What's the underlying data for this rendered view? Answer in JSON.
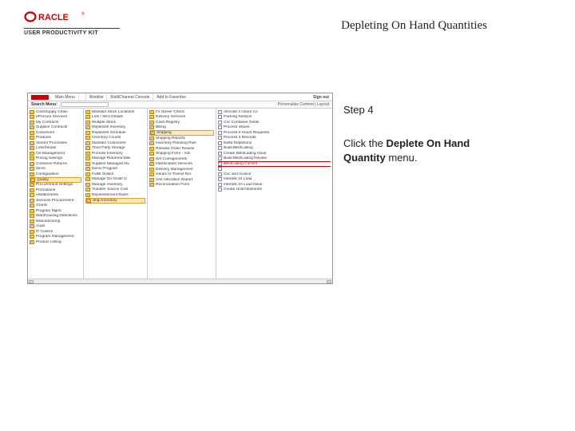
{
  "brand": {
    "upk": "USER PRODUCTIVITY KIT"
  },
  "title": "Depleting On Hand Quantities",
  "side": {
    "step": "Step 4",
    "instr_pre": "Click the ",
    "instr_bold": "Deplete On Hand Quantity",
    "instr_post": " menu."
  },
  "appbar": {
    "seg1": "Main Menu",
    "seg3": "Worklist",
    "seg4": "MultiChannel Console",
    "seg5": "Add to Favorites",
    "sign": "Sign out"
  },
  "subbar": {
    "label": "Search Menu:",
    "right": "Personalize Content | Layout"
  },
  "col0": [
    {
      "t": "folder",
      "l": "Cust/Supply Chain"
    },
    {
      "t": "folder",
      "l": "eProcure Services"
    },
    {
      "t": "folder",
      "l": "My Contracts"
    },
    {
      "t": "folder",
      "l": "Supplier Contracts"
    },
    {
      "t": "folder",
      "l": "Customers"
    },
    {
      "t": "folder",
      "l": "Products"
    },
    {
      "t": "folder",
      "l": "Vendor Processes"
    },
    {
      "t": "folder",
      "l": "Lots/Serials"
    },
    {
      "t": "folder",
      "l": "On-Management"
    },
    {
      "t": "folder",
      "l": "Pricing Savings"
    },
    {
      "t": "folder",
      "l": "Customer Returns"
    },
    {
      "t": "folder",
      "l": "Items"
    },
    {
      "t": "folder",
      "l": "Configuration"
    },
    {
      "t": "folder",
      "l": "Quality",
      "sel": true
    },
    {
      "t": "folder",
      "l": "Procurement Settings"
    },
    {
      "t": "folder",
      "l": "Promotions"
    },
    {
      "t": "folder",
      "l": "eSettlements"
    },
    {
      "t": "folder",
      "l": "Services Procurement"
    },
    {
      "t": "folder",
      "l": "Grants"
    },
    {
      "t": "folder",
      "l": "Program Mgmt"
    },
    {
      "t": "folder",
      "l": "Warehousing Definitions"
    },
    {
      "t": "folder",
      "l": "Manufacturing"
    },
    {
      "t": "folder",
      "l": "Audit"
    },
    {
      "t": "folder",
      "l": "IT Control"
    },
    {
      "t": "folder",
      "l": "Program Management"
    },
    {
      "t": "folder",
      "l": "Product Listing"
    }
  ],
  "col1": [
    {
      "t": "folder",
      "l": "Maintain Stock Locations"
    },
    {
      "t": "folder",
      "l": "Lots / SKU Details"
    },
    {
      "t": "folder",
      "l": "Multiple Stock"
    },
    {
      "t": "folder",
      "l": "Replenish Inventory"
    },
    {
      "t": "folder",
      "l": "Replenish Schedule"
    },
    {
      "t": "folder",
      "l": "Inventory Counts"
    },
    {
      "t": "folder",
      "l": "Maintain Customers"
    },
    {
      "t": "folder",
      "l": "Third Party Storage"
    },
    {
      "t": "folder",
      "l": "Promise Inventory"
    },
    {
      "t": "folder",
      "l": "Manage Returned Mat."
    },
    {
      "t": "folder",
      "l": "Supplier Managed Inv."
    },
    {
      "t": "folder",
      "l": "Demo Program"
    },
    {
      "t": "folder",
      "l": "Fulfill Orders"
    },
    {
      "t": "folder",
      "l": "Manage On-Order D"
    },
    {
      "t": "folder",
      "l": "Manage Inventory"
    },
    {
      "t": "folder",
      "l": "Transfer Source Cost"
    },
    {
      "t": "folder",
      "l": "Replenishment Rules"
    },
    {
      "t": "folder",
      "l": "Ship Inventory",
      "sel": true
    }
  ],
  "col2": [
    {
      "t": "folder",
      "l": "Fx Owner Check"
    },
    {
      "t": "folder",
      "l": "Delivery Services"
    },
    {
      "t": "folder",
      "l": "Cash Registry"
    },
    {
      "t": "folder",
      "l": "Billing"
    },
    {
      "t": "folder",
      "l": "Shipping",
      "sel": true
    },
    {
      "t": "folder",
      "l": "Shipping Reports"
    },
    {
      "t": "folder",
      "l": "Inventory Planning Rule"
    },
    {
      "t": "folder",
      "l": "Release Order Review"
    },
    {
      "t": "folder",
      "l": "Shipping Form - Adv"
    },
    {
      "t": "folder",
      "l": "Set Consignments"
    },
    {
      "t": "folder",
      "l": "Interlocation Services"
    },
    {
      "t": "folder",
      "l": "Delivery Management"
    },
    {
      "t": "folder",
      "l": "Issues In-Transit Rel."
    },
    {
      "t": "folder",
      "l": "Unit Allocation Report"
    },
    {
      "t": "folder",
      "l": "Reconciliation Form"
    }
  ],
  "col3": [
    {
      "t": "page",
      "l": "Allocate 2 Hours Co"
    },
    {
      "t": "page",
      "l": "Packing Session"
    },
    {
      "t": "page",
      "l": "Cnc Container Detail"
    },
    {
      "t": "page",
      "l": "Process Issues"
    },
    {
      "t": "page",
      "l": "Process 2 Hours Requests"
    },
    {
      "t": "page",
      "l": "Process 3 Records"
    },
    {
      "t": "page",
      "l": "Delta Depletions"
    },
    {
      "t": "page",
      "l": "Build BillofLading"
    },
    {
      "t": "page",
      "l": "Create BillofLading Issue"
    },
    {
      "t": "page",
      "l": "Build BillofLading Review"
    },
    {
      "t": "page",
      "l": "BillofLading Current",
      "bordered": true
    },
    {
      "t": "page",
      "l": ""
    },
    {
      "t": "page",
      "l": "Cnc and Invoice"
    },
    {
      "t": "page",
      "l": "Interlink 24 Load"
    },
    {
      "t": "page",
      "l": "Interlink 2A Load Issue"
    },
    {
      "t": "page",
      "l": "Create Unit/Allotments"
    }
  ]
}
